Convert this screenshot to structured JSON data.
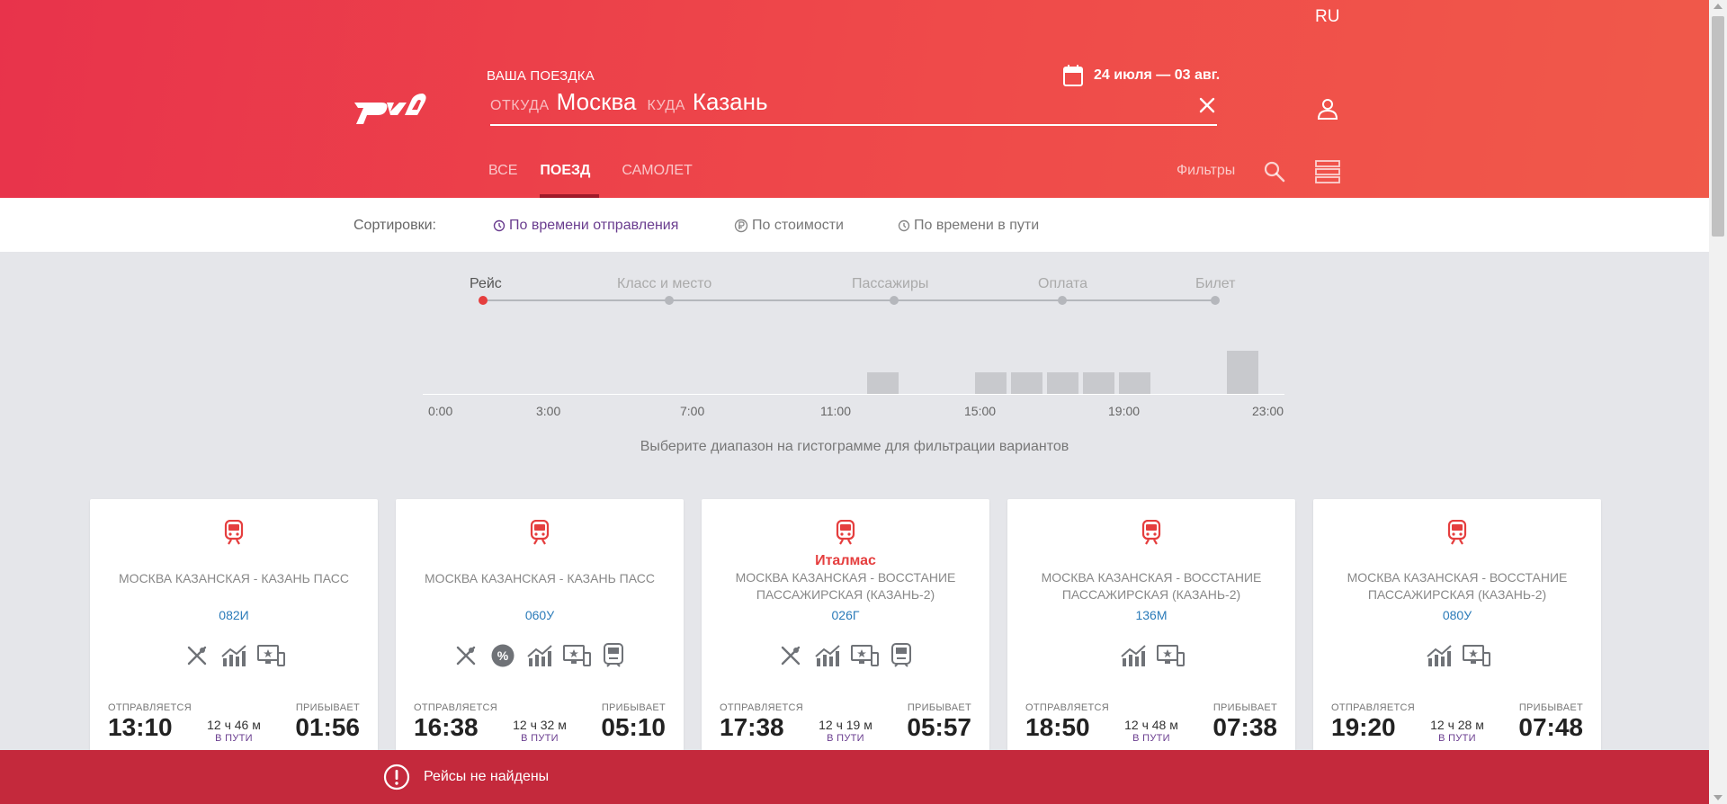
{
  "header": {
    "lang": "RU",
    "trip_label": "ВАША ПОЕЗДКА",
    "dates": "24 июля — 03 авг.",
    "from_label": "ОТКУДА",
    "from_city": "Москва",
    "to_label": "КУДА",
    "to_city": "Казань",
    "tabs": [
      "ВСЕ",
      "ПОЕЗД",
      "САМОЛЕТ"
    ],
    "active_tab": "ПОЕЗД",
    "filters_label": "Фильтры"
  },
  "sort": {
    "title": "Сортировки:",
    "options": [
      "По времени отправления",
      "По стоимости",
      "По времени в пути"
    ],
    "active": "По времени отправления"
  },
  "steps": {
    "labels": [
      "Рейс",
      "Класс и место",
      "Пассажиры",
      "Оплата",
      "Билет"
    ],
    "active": "Рейс"
  },
  "histogram": {
    "ticks": [
      "0:00",
      "3:00",
      "7:00",
      "11:00",
      "15:00",
      "19:00",
      "23:00"
    ],
    "hint": "Выберите диапазон на гистограмме для фильтрации вариантов",
    "bars": [
      {
        "hour": 13,
        "count": 1
      },
      {
        "hour": 16,
        "count": 1
      },
      {
        "hour": 17,
        "count": 1
      },
      {
        "hour": 18,
        "count": 1
      },
      {
        "hour": 19,
        "count": 1
      },
      {
        "hour": 20,
        "count": 1
      },
      {
        "hour": 23,
        "count": 2
      }
    ]
  },
  "cards": [
    {
      "brand": "",
      "route": "МОСКВА КАЗАНСКАЯ - КАЗАНЬ ПАСС",
      "number": "082И",
      "amenities": [
        "restaurant-icon",
        "trend-icon",
        "media-icon"
      ],
      "dep_label": "ОТПРАВЛЯЕТСЯ",
      "dep_time": "13:10",
      "duration": "12 ч 46 м",
      "on_way": "В ПУТИ",
      "arr_label": "ПРИБЫВАЕТ",
      "arr_time": "01:56"
    },
    {
      "brand": "",
      "route": "МОСКВА КАЗАНСКАЯ - КАЗАНЬ ПАСС",
      "number": "060У",
      "amenities": [
        "restaurant-icon",
        "discount-icon",
        "trend-icon",
        "media-icon",
        "train-car-icon"
      ],
      "dep_label": "ОТПРАВЛЯЕТСЯ",
      "dep_time": "16:38",
      "duration": "12 ч 32 м",
      "on_way": "В ПУТИ",
      "arr_label": "ПРИБЫВАЕТ",
      "arr_time": "05:10"
    },
    {
      "brand": "Италмас",
      "route": "МОСКВА КАЗАНСКАЯ - ВОССТАНИЕ ПАССАЖИРСКАЯ (КАЗАНЬ-2)",
      "number": "026Г",
      "amenities": [
        "restaurant-icon",
        "trend-icon",
        "media-icon",
        "train-car-icon"
      ],
      "dep_label": "ОТПРАВЛЯЕТСЯ",
      "dep_time": "17:38",
      "duration": "12 ч 19 м",
      "on_way": "В ПУТИ",
      "arr_label": "ПРИБЫВАЕТ",
      "arr_time": "05:57"
    },
    {
      "brand": "",
      "route": "МОСКВА КАЗАНСКАЯ - ВОССТАНИЕ ПАССАЖИРСКАЯ (КАЗАНЬ-2)",
      "number": "136М",
      "amenities": [
        "trend-icon",
        "media-icon"
      ],
      "dep_label": "ОТПРАВЛЯЕТСЯ",
      "dep_time": "18:50",
      "duration": "12 ч 48 м",
      "on_way": "В ПУТИ",
      "arr_label": "ПРИБЫВАЕТ",
      "arr_time": "07:38"
    },
    {
      "brand": "",
      "route": "МОСКВА КАЗАНСКАЯ - ВОССТАНИЕ ПАССАЖИРСКАЯ (КАЗАНЬ-2)",
      "number": "080У",
      "amenities": [
        "trend-icon",
        "media-icon"
      ],
      "dep_label": "ОТПРАВЛЯЕТСЯ",
      "dep_time": "19:20",
      "duration": "12 ч 28 м",
      "on_way": "В ПУТИ",
      "arr_label": "ПРИБЫВАЕТ",
      "arr_time": "07:48"
    }
  ],
  "notice": {
    "message": "Рейсы не найдены"
  },
  "colors": {
    "brand_red": "#e53e3e",
    "header_gradient_start": "#e8334b",
    "header_gradient_end": "#f0594a",
    "accent_purple": "#6a3d8f",
    "link_blue": "#2b7bb9",
    "notice_red": "#c4293c"
  }
}
